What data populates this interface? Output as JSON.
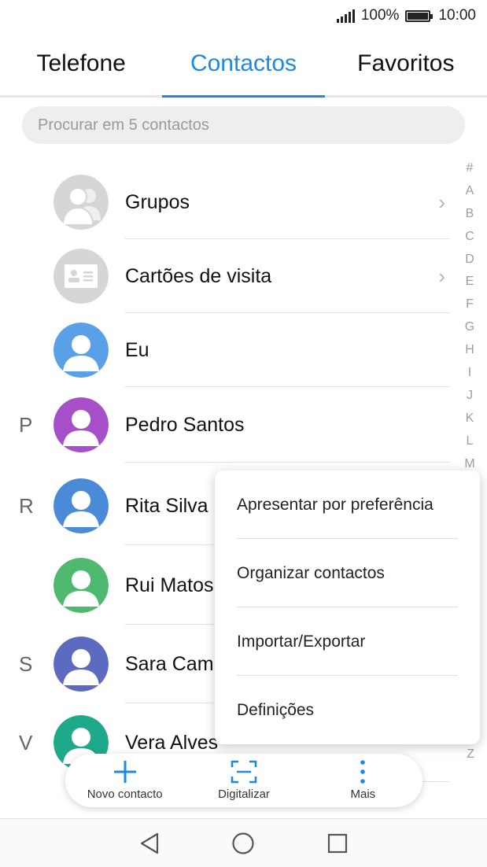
{
  "status_bar": {
    "battery_percent": "100%",
    "time": "10:00",
    "icons": [
      "signal-icon",
      "battery-icon"
    ]
  },
  "tabs": [
    {
      "label": "Telefone",
      "active": false
    },
    {
      "label": "Contactos",
      "active": true
    },
    {
      "label": "Favoritos",
      "active": false
    }
  ],
  "search": {
    "placeholder": "Procurar em 5 contactos",
    "value": ""
  },
  "alphabet_index": [
    "#",
    "A",
    "B",
    "C",
    "D",
    "E",
    "F",
    "G",
    "H",
    "I",
    "J",
    "K",
    "L",
    "M",
    "Z"
  ],
  "list": {
    "groups": {
      "label": "Grupos",
      "icon": "groups-icon"
    },
    "business_cards": {
      "label": "Cartões de visita",
      "icon": "business-card-icon"
    },
    "me": {
      "label": "Eu"
    },
    "contacts": [
      {
        "letter": "P",
        "name": "Pedro Santos",
        "color": "#a64fc8"
      },
      {
        "letter": "R",
        "name": "Rita Silva",
        "color": "#4a8ad6"
      },
      {
        "letter": "",
        "name": "Rui Matos",
        "color": "#4fba6f"
      },
      {
        "letter": "S",
        "name": "Sara Camp",
        "color": "#5c6bc0"
      },
      {
        "letter": "V",
        "name": "Vera Alves",
        "color": "#1eaa8a"
      }
    ]
  },
  "menu": {
    "items": [
      "Apresentar por preferência",
      "Organizar contactos",
      "Importar/Exportar",
      "Definições"
    ]
  },
  "action_bar": {
    "new_contact": "Novo contacto",
    "scan": "Digitalizar",
    "more": "Mais"
  },
  "nav": {
    "buttons": [
      "back-icon",
      "home-icon",
      "recents-icon"
    ]
  },
  "colors": {
    "accent": "#1e88e5",
    "me_avatar": "#5aa0e6"
  }
}
